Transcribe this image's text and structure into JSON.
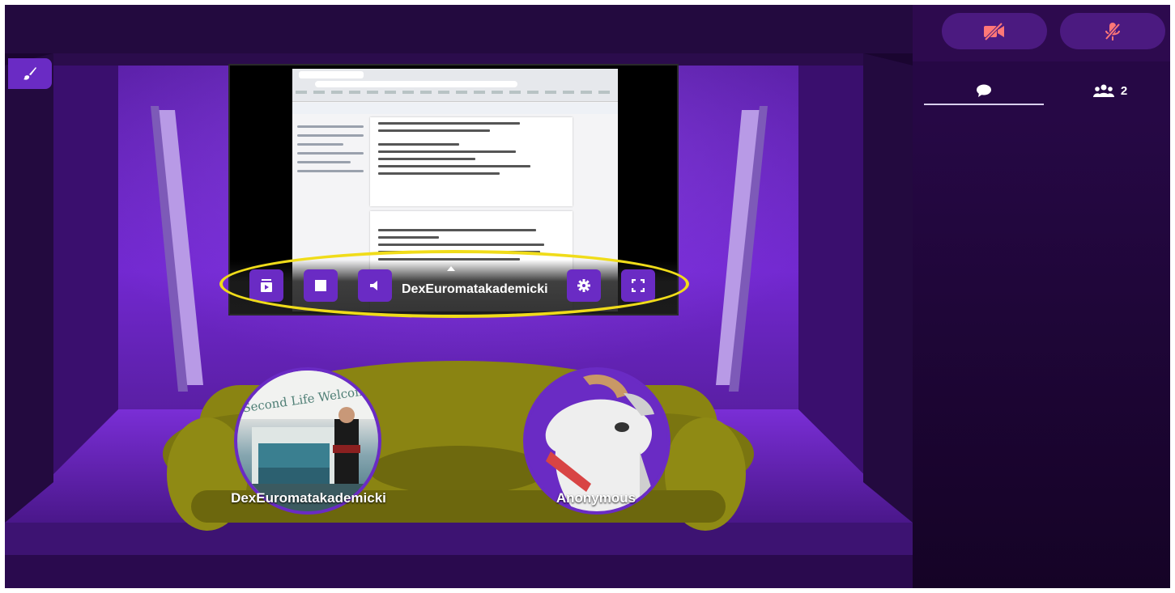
{
  "room": {
    "screen_share": {
      "presenter_name": "DexEuromatakademicki",
      "controls": [
        "play-queue",
        "stop",
        "volume",
        "settings",
        "fullscreen"
      ]
    },
    "participants": [
      {
        "name": "DexEuromatakademicki",
        "avatar": "photo"
      },
      {
        "name": "Anonymous",
        "avatar": "goat"
      }
    ],
    "colors": {
      "accent": "#6a2bc4",
      "highlight": "#f0dc1a",
      "couch": "#8a8412"
    }
  },
  "sidebar": {
    "media_buttons": [
      {
        "icon": "camera-off-icon"
      },
      {
        "icon": "microphone-muted-icon"
      }
    ],
    "tabs": [
      {
        "icon": "chat-bubble-icon",
        "label": ""
      },
      {
        "icon": "users-icon",
        "label": "2"
      }
    ]
  }
}
